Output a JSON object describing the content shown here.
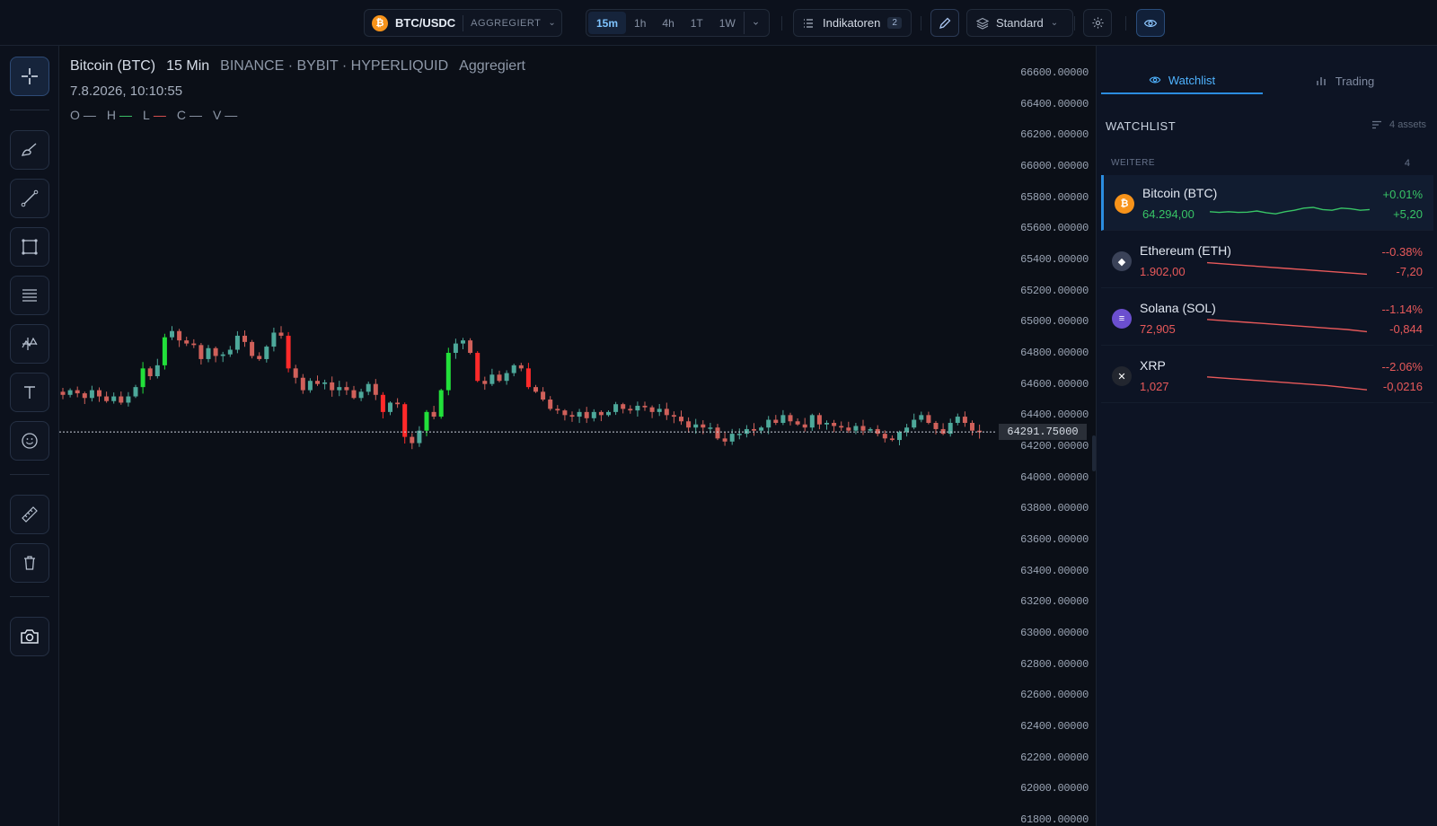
{
  "topbar": {
    "symbol": "BTC/USDC",
    "symbol_coin_glyph": "₿",
    "source_mode": "AGGREGIERT",
    "timeframes": [
      "15m",
      "1h",
      "4h",
      "1T",
      "1W"
    ],
    "active_timeframe": "15m",
    "indicators_label": "Indikatoren",
    "indicators_count": "2",
    "style_label": "Standard"
  },
  "left_tools": [
    {
      "name": "crosshair-icon",
      "active": true
    },
    {
      "name": "brush-icon"
    },
    {
      "name": "trend-line-icon"
    },
    {
      "name": "rectangle-icon"
    },
    {
      "name": "fib-lines-icon"
    },
    {
      "name": "pattern-icon"
    },
    {
      "name": "text-icon"
    },
    {
      "name": "emoji-icon"
    },
    {
      "name": "ruler-icon"
    },
    {
      "name": "trash-icon"
    },
    {
      "name": "camera-icon"
    }
  ],
  "legend": {
    "title": "Bitcoin (BTC)",
    "interval": "15 Min",
    "exchanges": "BINANCE · BYBIT · HYPERLIQUID",
    "mode": "Aggregiert",
    "datetime": "7.8.2026, 10:10:55",
    "ohlcv": [
      {
        "key": "O",
        "val": "—",
        "color": "none"
      },
      {
        "key": "H",
        "val": "—",
        "color": "green"
      },
      {
        "key": "L",
        "val": "—",
        "color": "red"
      },
      {
        "key": "C",
        "val": "—",
        "color": "none"
      },
      {
        "key": "V",
        "val": "—",
        "color": "none"
      }
    ]
  },
  "price_axis": {
    "ticks": [
      "66600.00000",
      "66400.00000",
      "66200.00000",
      "66000.00000",
      "65800.00000",
      "65600.00000",
      "65400.00000",
      "65200.00000",
      "65000.00000",
      "64800.00000",
      "64600.00000",
      "64400.00000",
      "64200.00000",
      "64000.00000",
      "63800.00000",
      "63600.00000",
      "63400.00000",
      "63200.00000",
      "63000.00000",
      "62800.00000",
      "62600.00000",
      "62400.00000",
      "62200.00000",
      "62000.00000",
      "61800.00000"
    ],
    "last_price": "64291.75000",
    "last_price_value": 64291.75
  },
  "chart_data": {
    "type": "candlestick",
    "ylim": [
      61800,
      66600
    ],
    "up_color": "#26a69a",
    "down_color": "#ef5350",
    "closes": [
      64530,
      64560,
      64540,
      64510,
      64560,
      64520,
      64490,
      64520,
      64480,
      64520,
      64580,
      64700,
      64650,
      64720,
      64900,
      64940,
      64880,
      64860,
      64850,
      64760,
      64830,
      64780,
      64790,
      64820,
      64910,
      64870,
      64780,
      64760,
      64840,
      64930,
      64910,
      64700,
      64640,
      64560,
      64620,
      64600,
      64610,
      64560,
      64580,
      64560,
      64510,
      64550,
      64600,
      64530,
      64420,
      64480,
      64470,
      64260,
      64220,
      64300,
      64420,
      64390,
      64560,
      64800,
      64860,
      64880,
      64800,
      64620,
      64600,
      64660,
      64620,
      64670,
      64720,
      64700,
      64580,
      64550,
      64500,
      64440,
      64430,
      64400,
      64390,
      64420,
      64380,
      64420,
      64400,
      64420,
      64470,
      64440,
      64430,
      64460,
      64450,
      64420,
      64440,
      64400,
      64390,
      64360,
      64320,
      64340,
      64320,
      64320,
      64250,
      64230,
      64280,
      64280,
      64310,
      64300,
      64320,
      64370,
      64350,
      64400,
      64360,
      64340,
      64320,
      64400,
      64340,
      64350,
      64330,
      64320,
      64300,
      64330,
      64300,
      64310,
      64280,
      64250,
      64240,
      64290,
      64320,
      64370,
      64400,
      64350,
      64310,
      64280,
      64350,
      64390,
      64350,
      64300,
      64290
    ]
  },
  "watchlist": {
    "tab_watchlist": "Watchlist",
    "tab_trading": "Trading",
    "heading": "WATCHLIST",
    "asset_count": "4 assets",
    "group": "WEITERE",
    "group_count": "4",
    "items": [
      {
        "name": "Bitcoin (BTC)",
        "price": "64.294,00",
        "pct": "+0.01%",
        "chg": "+5,20",
        "dir": "up",
        "icon": "btc",
        "glyph": "₿",
        "color": "#f7931a",
        "spark": [
          0.55,
          0.6,
          0.55,
          0.6,
          0.58,
          0.5,
          0.62,
          0.7,
          0.55,
          0.45,
          0.3,
          0.25,
          0.4,
          0.45,
          0.3,
          0.35,
          0.45,
          0.4
        ]
      },
      {
        "name": "Ethereum (ETH)",
        "price": "1.902,00",
        "pct": "--0.38%",
        "chg": "-7,20",
        "dir": "down",
        "icon": "eth",
        "glyph": "◆",
        "color": "#3a4258",
        "spark": [
          0.1,
          0.2,
          0.3,
          0.4,
          0.5,
          0.6,
          0.7,
          0.8,
          0.9
        ]
      },
      {
        "name": "Solana (SOL)",
        "price": "72,905",
        "pct": "--1.14%",
        "chg": "-0,844",
        "dir": "down",
        "icon": "sol",
        "glyph": "≡",
        "color": "#6b4fcf",
        "spark": [
          0.05,
          0.15,
          0.25,
          0.35,
          0.45,
          0.55,
          0.65,
          0.75,
          0.9
        ]
      },
      {
        "name": "XRP",
        "price": "1,027",
        "pct": "--2.06%",
        "chg": "-0,0216",
        "dir": "down",
        "icon": "xrp",
        "glyph": "✕",
        "color": "#22262f",
        "spark": [
          0.05,
          0.15,
          0.25,
          0.35,
          0.45,
          0.55,
          0.65,
          0.8,
          0.95
        ]
      }
    ]
  }
}
